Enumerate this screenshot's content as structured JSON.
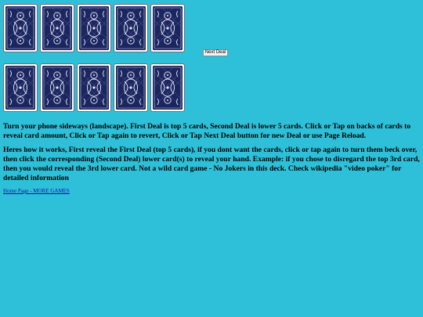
{
  "deal": {
    "first_row_count": 5,
    "second_row_count": 5,
    "card_back_color": "#1b2660",
    "card_face_color": "#ffffff"
  },
  "controls": {
    "next_deal_label": "Next Deal"
  },
  "instructions": {
    "para1": "Turn your phone sideways (landscape). First Deal is top 5 cards, Second Deal is lower 5 cards. Click or Tap on backs of cards to reveal card amount, Click or Tap again to revert, Click or Tap Next Deal button for new Deal or use Page Reload.",
    "para2": "Heres how it works, First reveal the First Deal (top 5 cards), if you dont want the cards, click or tap again to turn them beck over, then click the corresponding (Second Deal) lower card(s) to reveal your hand. Example: if you chose to disregard the top 3rd card, then you would reveal the 3rd lower card. Not a wild card game - No Jokers in this deck. Check wikipedia \"video poker\" for detailed information"
  },
  "links": {
    "home_label": "Home Page - MORE GAMES"
  }
}
